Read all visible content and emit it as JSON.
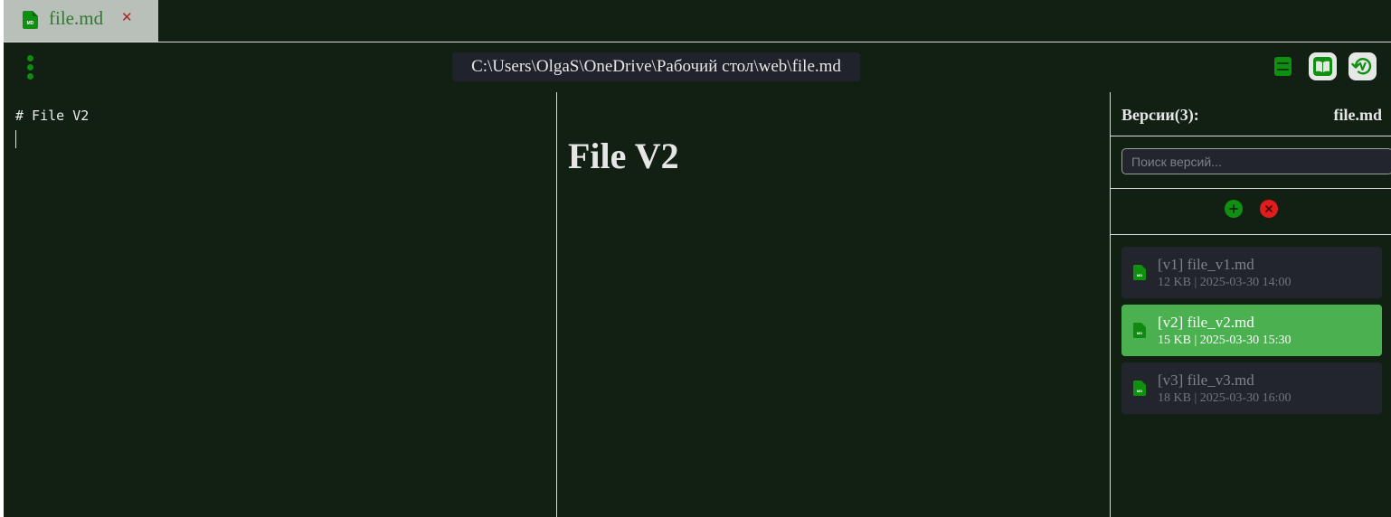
{
  "tab": {
    "label": "file.md",
    "close": "✕",
    "file_badge": "MD"
  },
  "toolbar": {
    "path": "C:\\Users\\OlgaS\\OneDrive\\Рабочий стол\\web\\file.md",
    "icons": [
      "more-vertical-icon",
      "storage-icon",
      "book-icon",
      "history-icon"
    ]
  },
  "editor": {
    "content": "# File V2"
  },
  "preview": {
    "heading": "File V2"
  },
  "versions": {
    "title": "Версии(3):",
    "file": "file.md",
    "search_placeholder": "Поиск версий...",
    "add": "+",
    "remove": "✕",
    "items": [
      {
        "name": "[v1] file_v1.md",
        "meta": "12 KB | 2025-03-30 14:00",
        "active": false
      },
      {
        "name": "[v2] file_v2.md",
        "meta": "15 KB | 2025-03-30 15:30",
        "active": true
      },
      {
        "name": "[v3] file_v3.md",
        "meta": "18 KB | 2025-03-30 16:00",
        "active": false
      }
    ]
  },
  "colors": {
    "background": "#112013",
    "accent_green": "#108a10",
    "active_item": "#4bb04f",
    "danger": "#e01c1c"
  }
}
